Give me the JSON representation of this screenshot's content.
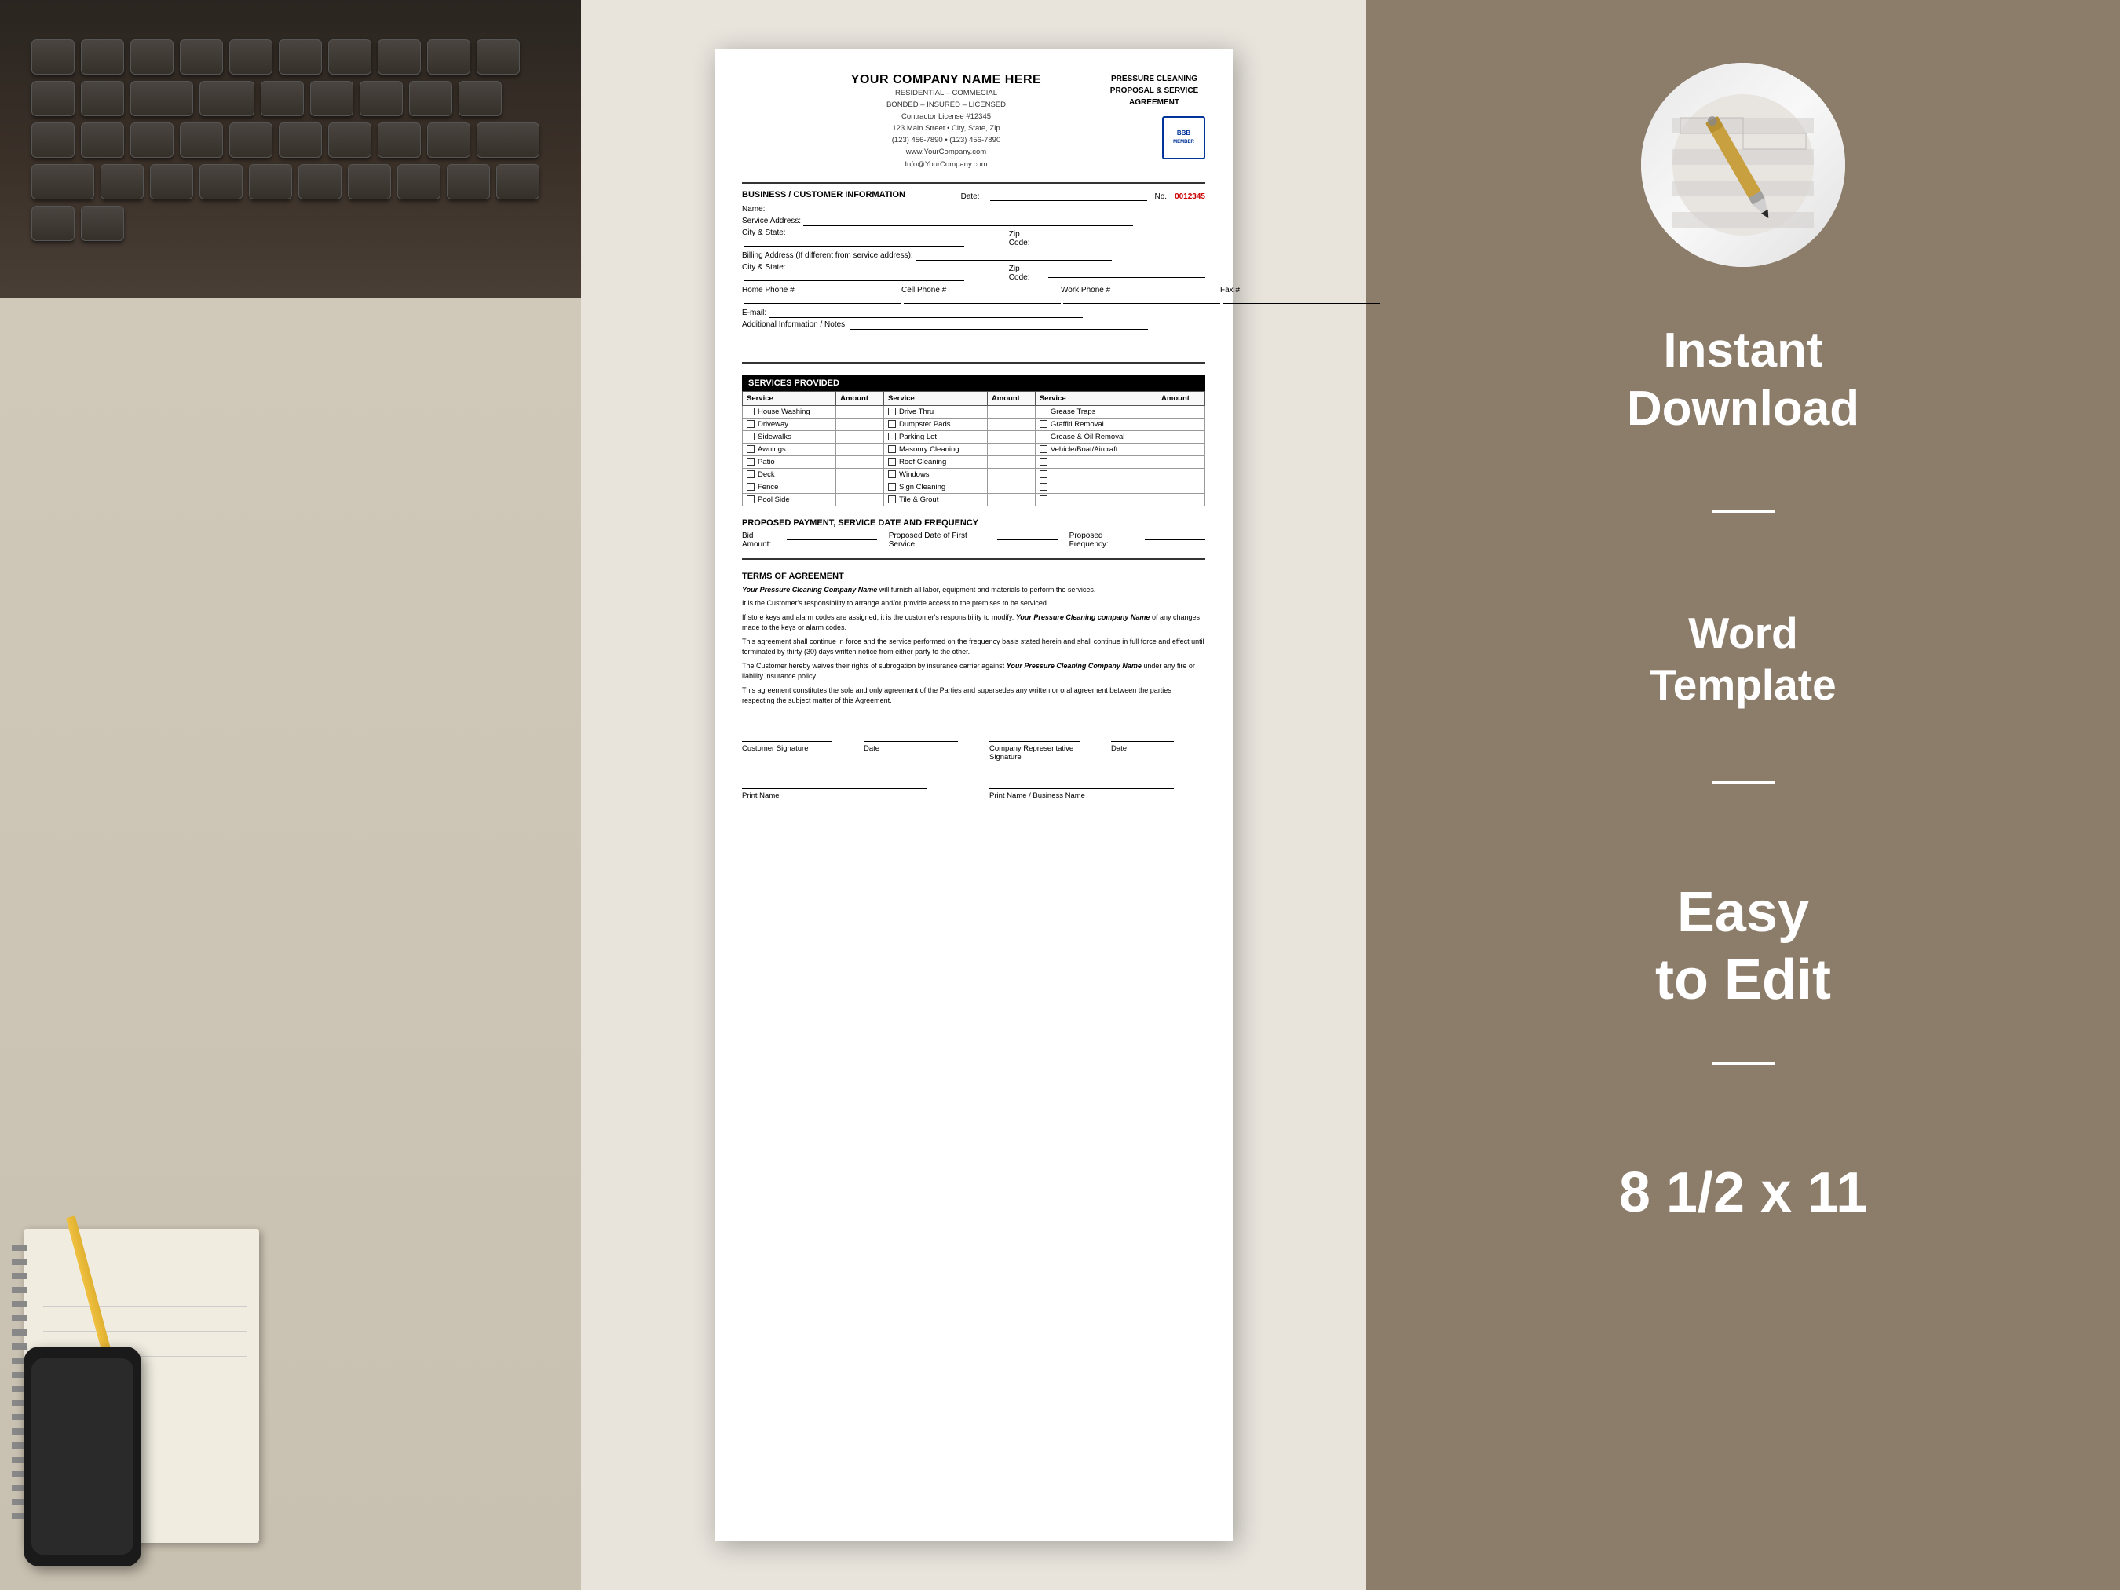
{
  "left_panel": {
    "aria_label": "decorative background photo"
  },
  "document": {
    "company_name": "YOUR COMPANY NAME HERE",
    "tagline1": "RESIDENTIAL – COMMECIAL",
    "tagline2": "BONDED – INSURED – LICENSED",
    "tagline3": "Contractor License #12345",
    "address": "123 Main Street • City, State, Zip",
    "phone": "(123) 456-7890 • (123) 456-7890",
    "website": "www.YourCompany.com",
    "email": "Info@YourCompany.com",
    "proposal_title_line1": "PRESSURE CLEANING",
    "proposal_title_line2": "PROPOSAL & SERVICE",
    "proposal_title_line3": "AGREEMENT",
    "customer_section_label": "BUSINESS / CUSTOMER INFORMATION",
    "date_label": "Date:",
    "number_label": "No.",
    "number_value": "0012345",
    "name_label": "Name:",
    "service_address_label": "Service Address:",
    "city_state_label": "City & State:",
    "zip_code_label": "Zip Code:",
    "billing_address_label": "Billing Address (If different from service address):",
    "billing_city_state_label": "City & State:",
    "billing_zip_label": "Zip Code:",
    "home_phone_label": "Home Phone #",
    "cell_phone_label": "Cell Phone #",
    "work_phone_label": "Work Phone #",
    "fax_label": "Fax #",
    "email_label": "E-mail:",
    "additional_info_label": "Additional Information / Notes:",
    "services_header": "SERVICES PROVIDED",
    "col_headers": [
      "Service",
      "Amount",
      "Service",
      "Amount",
      "Service",
      "Amount"
    ],
    "services_col1": [
      "House Washing",
      "Driveway",
      "Sidewalks",
      "Awnings",
      "Patio",
      "Deck",
      "Fence",
      "Pool Side"
    ],
    "services_col2": [
      "Drive Thru",
      "Dumpster Pads",
      "Parking Lot",
      "Masonry Cleaning",
      "Roof Cleaning",
      "Windows",
      "Sign Cleaning",
      "Tile & Grout"
    ],
    "services_col3": [
      "Grease Traps",
      "Graffiti Removal",
      "Grease & Oil Removal",
      "Vehicle/Boat/Aircraft",
      "",
      "",
      "",
      ""
    ],
    "payment_header": "PROPOSED PAYMENT, SERVICE DATE AND FREQUENCY",
    "bid_amount_label": "Bid Amount:",
    "proposed_date_label": "Proposed Date of First Service:",
    "proposed_freq_label": "Proposed Frequency:",
    "terms_header": "TERMS OF AGREEMENT",
    "terms_lines": [
      {
        "italic_start": "Your Pressure Cleaning Company Name",
        "rest": " will furnish all labor, equipment and materials to perform the services."
      },
      {
        "text": "It is the Customer's responsibility to arrange and/or provide access to the premises to be serviced."
      },
      {
        "text_start": "If store keys and alarm codes are assigned, it is the customer's responsibility to modify. ",
        "italic": "Your Pressure Cleaning company Name",
        "text_end": " of any changes made to the keys or alarm codes."
      },
      {
        "text": "This agreement shall continue in force and the service performed on the frequency basis stated herein and shall continue in full force and effect until terminated by thirty (30) days written notice from either party to the other."
      },
      {
        "text_start": "The Customer hereby waives their rights of subrogation by insurance carrier against ",
        "italic": "Your Pressure Cleaning Company Name",
        "text_end": " under any fire or liability insurance policy."
      },
      {
        "text": "This agreement constitutes the sole and only agreement of the Parties and supersedes any written or oral agreement between the parties respecting the subject matter of this Agreement."
      }
    ],
    "customer_sig_label": "Customer Signature",
    "date_sig_label": "Date",
    "company_rep_sig_label": "Company Representative Signature",
    "company_date_label": "Date",
    "print_name_label": "Print Name",
    "print_name_business_label": "Print Name / Business Name"
  },
  "right_panel": {
    "pen_icon": "✒",
    "instant_download_line1": "Instant",
    "instant_download_line2": "Download",
    "word_template_line1": "Word",
    "word_template_line2": "Template",
    "easy_edit_line1": "Easy",
    "easy_edit_line2": "to Edit",
    "size_label": "8 1/2 x 11"
  }
}
